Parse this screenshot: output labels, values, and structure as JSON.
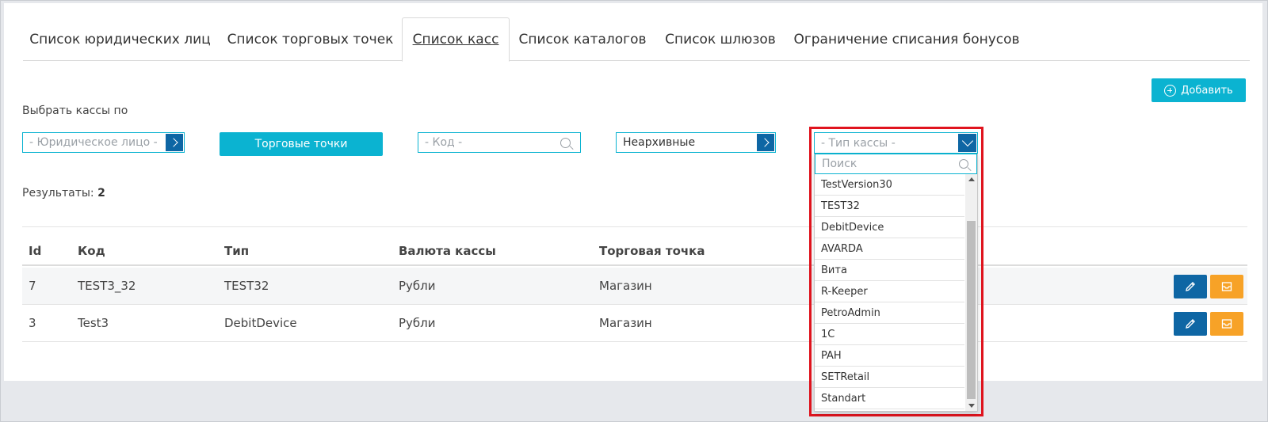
{
  "tabs": [
    {
      "label": "Список юридических лиц",
      "active": false
    },
    {
      "label": "Список торговых точек",
      "active": false
    },
    {
      "label": "Список касс",
      "active": true
    },
    {
      "label": "Список каталогов",
      "active": false
    },
    {
      "label": "Список шлюзов",
      "active": false
    },
    {
      "label": "Ограничение списания бонусов",
      "active": false
    }
  ],
  "add_button": "Добавить",
  "filters": {
    "label": "Выбрать кассы по",
    "legal_entity_placeholder": "- Юридическое лицо -",
    "outlets_button": "Торговые точки",
    "code_placeholder": "- Код -",
    "archive_value": "Неархивные",
    "register_type_placeholder": "- Тип кассы -"
  },
  "results": {
    "label": "Результаты:",
    "count": "2"
  },
  "table": {
    "columns": [
      "Id",
      "Код",
      "Тип",
      "Валюта кассы",
      "Торговая точка"
    ],
    "rows": [
      {
        "id": "7",
        "code": "TEST3_32",
        "type": "TEST32",
        "currency": "Рубли",
        "outlet": "Магазин"
      },
      {
        "id": "3",
        "code": "Test3",
        "type": "DebitDevice",
        "currency": "Рубли",
        "outlet": "Магазин"
      }
    ]
  },
  "dropdown": {
    "search_placeholder": "Поиск",
    "items": [
      "TestVersion30",
      "TEST32",
      "DebitDevice",
      "AVARDA",
      "Вита",
      "R-Keeper",
      "PetroAdmin",
      "1C",
      "PAH",
      "SETRetail",
      "Standart"
    ]
  },
  "colors": {
    "accent": "#0bb3d1",
    "dark_blue": "#0e66a4",
    "orange": "#f7a227",
    "highlight_red": "#e0141e"
  },
  "icons": {
    "add": "plus-circle-icon",
    "edit": "pencil-icon",
    "archive": "archive-box-icon",
    "search": "search-icon"
  }
}
